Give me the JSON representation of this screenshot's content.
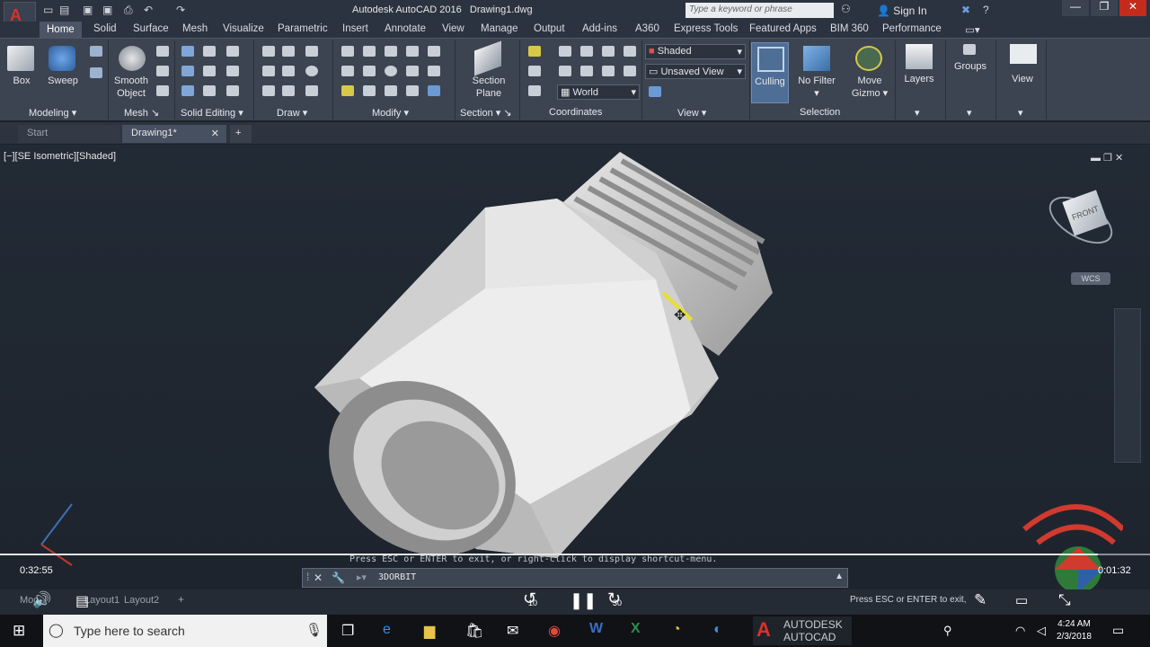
{
  "title_bar": {
    "app_title": "Autodesk AutoCAD 2016",
    "document": "Drawing1.dwg",
    "search_placeholder": "Type a keyword or phrase",
    "sign_in": "Sign In"
  },
  "ribbon_tabs": [
    "Home",
    "Solid",
    "Surface",
    "Mesh",
    "Visualize",
    "Parametric",
    "Insert",
    "Annotate",
    "View",
    "Manage",
    "Output",
    "Add-ins",
    "A360",
    "Express Tools",
    "Featured Apps",
    "BIM 360",
    "Performance"
  ],
  "ribbon": {
    "buttons": {
      "box": "Box",
      "sweep": "Sweep",
      "smooth_object": [
        "Smooth",
        "Object"
      ],
      "section_plane": [
        "Section",
        "Plane"
      ],
      "culling": "Culling",
      "no_filter": "No Filter",
      "move_gizmo": [
        "Move",
        "Gizmo"
      ],
      "layers": "Layers",
      "groups": "Groups",
      "view": "View"
    },
    "dropdowns": {
      "visual_style": "Shaded",
      "named_view": "Unsaved View",
      "ucs": "World"
    },
    "panels": [
      "Modeling",
      "Mesh",
      "Solid Editing",
      "Draw",
      "Modify",
      "Section",
      "Coordinates",
      "View",
      "Selection"
    ]
  },
  "doc_tabs": [
    "Start",
    "Drawing1*"
  ],
  "viewport": {
    "label": "[−][SE Isometric][Shaded]",
    "viewcube_face": "FRONT",
    "wcs_label": "WCS"
  },
  "command": {
    "hint": "Press ESC or ENTER to exit, or right-click to display shortcut-menu.",
    "current": "3DORBIT"
  },
  "video": {
    "elapsed": "0:32:55",
    "remaining": "0:01:32",
    "skip_back": "10",
    "skip_forward": "30",
    "progress": 0.955
  },
  "layout_tabs": [
    "Model",
    "Layout1",
    "Layout2"
  ],
  "status_hint": "Press ESC or ENTER to exit, or right-click to display shortcut-menu.",
  "taskbar": {
    "search_placeholder": "Type here to search",
    "brand": [
      "AUTODESK",
      "AUTOCAD"
    ],
    "time": "4:24 AM",
    "date": "2/3/2018"
  },
  "colors": {
    "accent": "#3e6fb3",
    "model_body": "#d8d8d8",
    "viewport_bg": "#1f2630"
  }
}
